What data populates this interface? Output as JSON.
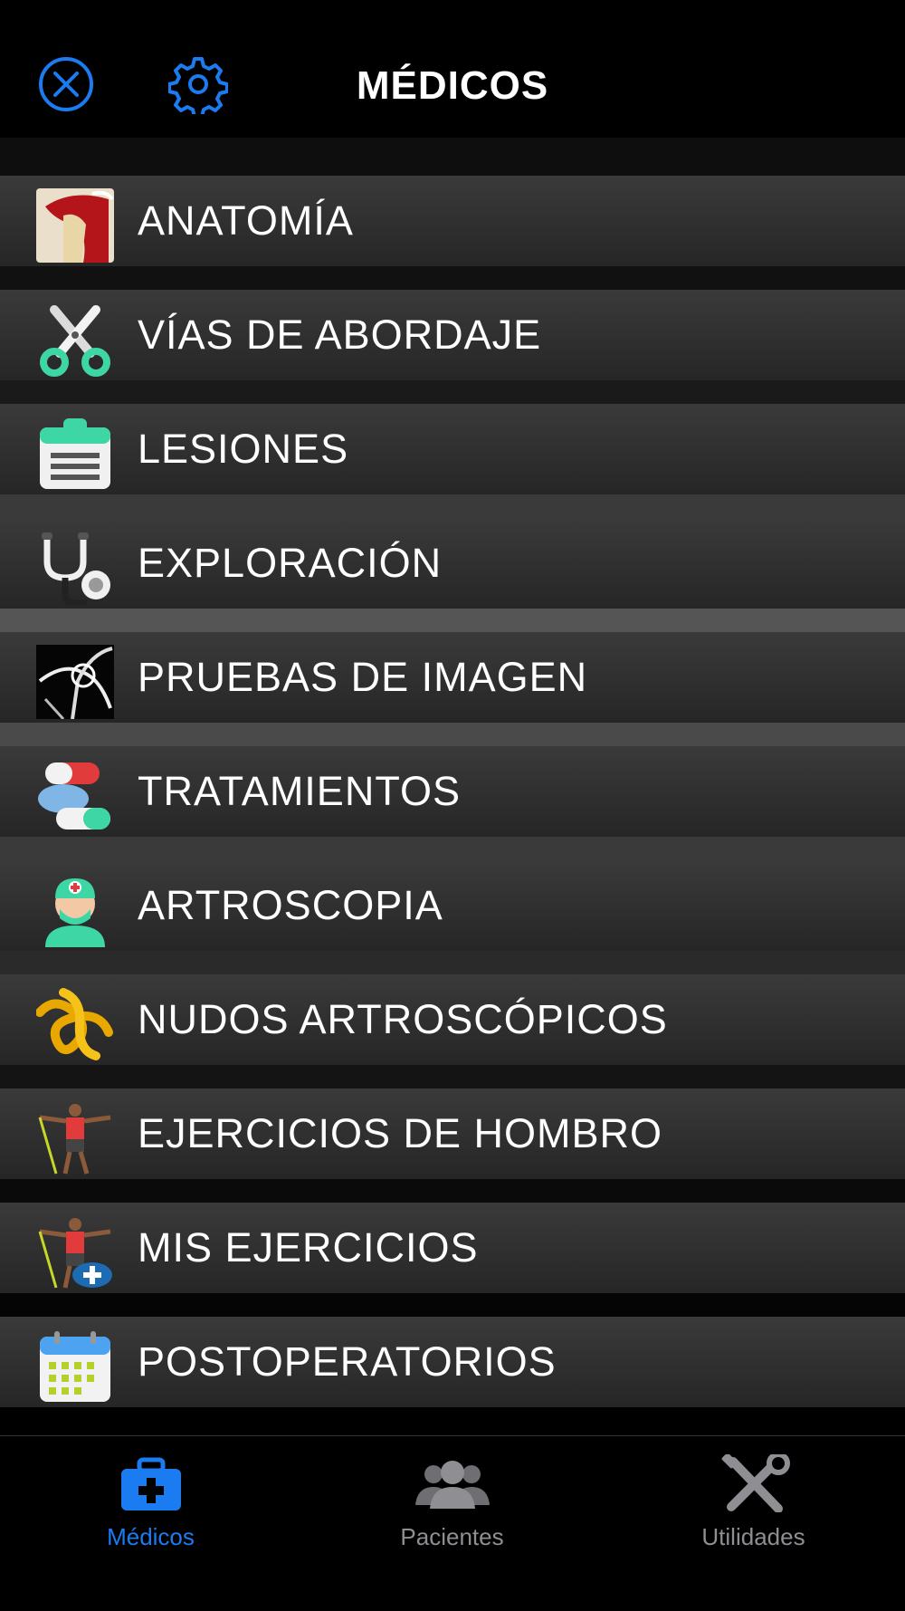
{
  "header": {
    "title": "MÉDICOS",
    "close_icon": "close-circle-icon",
    "settings_icon": "gear-icon"
  },
  "menu": {
    "items": [
      {
        "label": "ANATOMÍA",
        "icon": "shoulder-anatomy-icon"
      },
      {
        "label": "VÍAS DE ABORDAJE",
        "icon": "scissors-icon"
      },
      {
        "label": "LESIONES",
        "icon": "clipboard-icon"
      },
      {
        "label": "EXPLORACIÓN",
        "icon": "stethoscope-icon"
      },
      {
        "label": "PRUEBAS DE IMAGEN",
        "icon": "xray-icon"
      },
      {
        "label": "TRATAMIENTOS",
        "icon": "pills-icon"
      },
      {
        "label": "ARTROSCOPIA",
        "icon": "surgeon-icon"
      },
      {
        "label": "NUDOS ARTROSCÓPICOS",
        "icon": "knot-icon"
      },
      {
        "label": "EJERCICIOS DE HOMBRO",
        "icon": "exercise-band-icon"
      },
      {
        "label": "MIS EJERCICIOS",
        "icon": "my-exercise-icon"
      },
      {
        "label": "POSTOPERATORIOS",
        "icon": "calendar-icon"
      }
    ]
  },
  "tabbar": {
    "tabs": [
      {
        "label": "Médicos",
        "icon": "medical-bag-icon",
        "active": true
      },
      {
        "label": "Pacientes",
        "icon": "people-icon",
        "active": false
      },
      {
        "label": "Utilidades",
        "icon": "tools-icon",
        "active": false
      }
    ]
  },
  "colors": {
    "accent": "#1a7cf0",
    "background": "#000000",
    "row": "#2f2f2f",
    "inactive_tab": "#8e8e93"
  }
}
